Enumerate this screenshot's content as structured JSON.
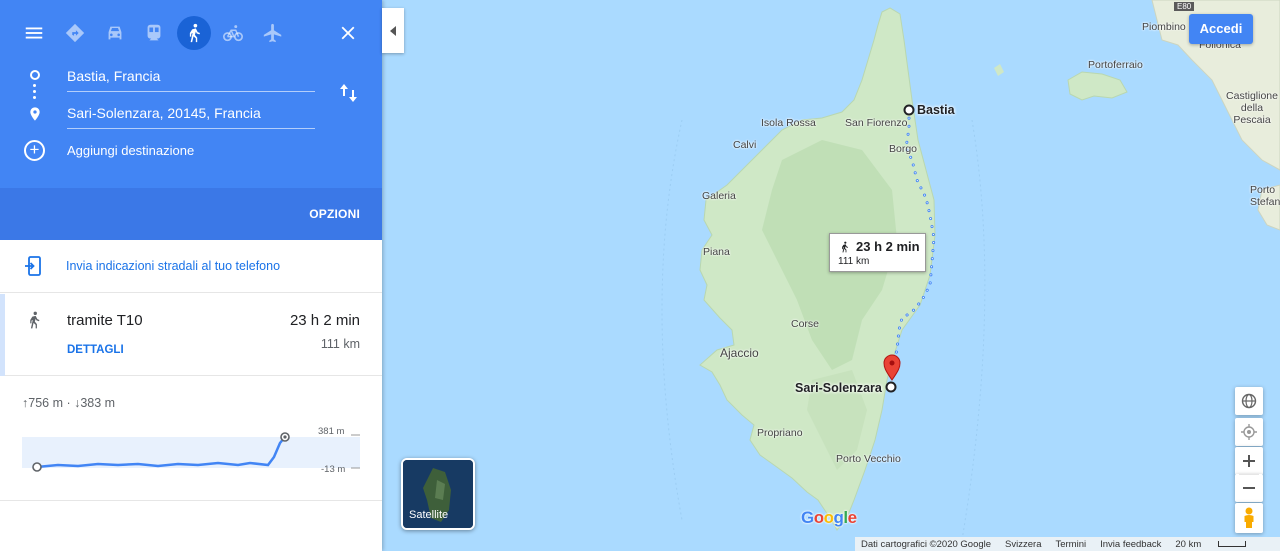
{
  "directions": {
    "modes": [
      {
        "name": "best",
        "label": "Percorso migliore"
      },
      {
        "name": "car",
        "label": "Auto"
      },
      {
        "name": "transit",
        "label": "Mezzi pubblici"
      },
      {
        "name": "walk",
        "label": "A piedi"
      },
      {
        "name": "bike",
        "label": "Bicicletta"
      },
      {
        "name": "flight",
        "label": "Aereo"
      }
    ],
    "active_mode": "walk",
    "origin": "Bastia, Francia",
    "destination": "Sari-Solenzara, 20145, Francia",
    "add_destination": "Aggiungi destinazione",
    "options": "OPZIONI",
    "send_to_phone": "Invia indicazioni stradali al tuo telefono"
  },
  "route": {
    "via": "tramite T10",
    "duration": "23 h 2 min",
    "distance": "111 km",
    "details": "DETTAGLI"
  },
  "elevation": {
    "summary": "↑756 m · ↓383 m",
    "max_label": "381 m",
    "min_label": "-13 m"
  },
  "map": {
    "route_bubble": {
      "duration": "23 h 2 min",
      "distance": "111 km"
    },
    "origin_label": "Bastia",
    "destination_label": "Sari-Solenzara",
    "places": [
      "Isola Rossa",
      "San Fiorenzo",
      "Borgo",
      "Calvi",
      "Galeria",
      "Piana",
      "Corse",
      "Ajaccio",
      "Propriano",
      "Porto Vecchio",
      "Portoferraio",
      "Piombino",
      "Follonica",
      "Castiglione della Pescaia",
      "Porto Stefano"
    ],
    "satellite_label": "Satellite",
    "sign_in": "Accedi",
    "road_shield": "E80",
    "attribution": {
      "data": "Dati cartografici ©2020 Google",
      "country": "Svizzera",
      "terms": "Termini",
      "feedback": "Invia feedback",
      "scale": "20 km"
    },
    "logo": "Google",
    "colors": {
      "route": "#4285f4",
      "land": "#cfe8c6",
      "sea": "#aadaff",
      "pin": "#ea4335"
    }
  }
}
